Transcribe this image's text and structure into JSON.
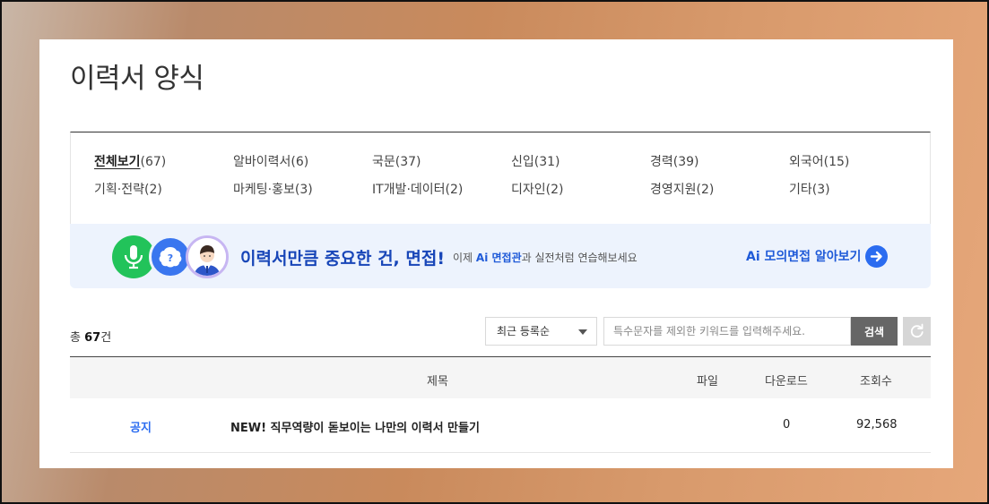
{
  "page": {
    "title": "이력서 양식"
  },
  "categories": [
    {
      "name": "전체보기",
      "count": "(67)",
      "active": true
    },
    {
      "name": "알바이력서",
      "count": "(6)"
    },
    {
      "name": "국문",
      "count": "(37)"
    },
    {
      "name": "신입",
      "count": "(31)"
    },
    {
      "name": "경력",
      "count": "(39)"
    },
    {
      "name": "외국어",
      "count": "(15)"
    },
    {
      "name": "기획·전략",
      "count": "(2)"
    },
    {
      "name": "마케팅·홍보",
      "count": "(3)"
    },
    {
      "name": "IT개발·데이터",
      "count": "(2)"
    },
    {
      "name": "디자인",
      "count": "(2)"
    },
    {
      "name": "경영지원",
      "count": "(2)"
    },
    {
      "name": "기타",
      "count": "(3)"
    }
  ],
  "banner": {
    "headline": "이력서만큼 중요한 건, 면접!",
    "sub_prefix": "이제 ",
    "sub_highlight": "Ai 면접관",
    "sub_suffix": "과 실전처럼 연습해보세요",
    "link_label": "Ai 모의면접 알아보기",
    "icons": [
      "microphone-icon",
      "ai-bot-icon",
      "interviewer-avatar-icon",
      "arrow-right-icon"
    ]
  },
  "list": {
    "total_prefix": "총 ",
    "total_count": "67",
    "total_suffix": "건",
    "sort_selected": "최근 등록순",
    "search_placeholder": "특수문자를 제외한 키워드를 입력해주세요.",
    "search_label": "검색"
  },
  "table": {
    "headers": {
      "title": "제목",
      "file": "파일",
      "downloads": "다운로드",
      "views": "조회수"
    },
    "rows": [
      {
        "type": "공지",
        "title": "NEW! 직무역량이 돋보이는 나만의 이력서 만들기",
        "file": "",
        "downloads": "0",
        "views": "92,568"
      }
    ]
  },
  "colors": {
    "accent": "#2b6cf0",
    "banner_bg": "#edf3fd",
    "headline": "#1846b8"
  }
}
